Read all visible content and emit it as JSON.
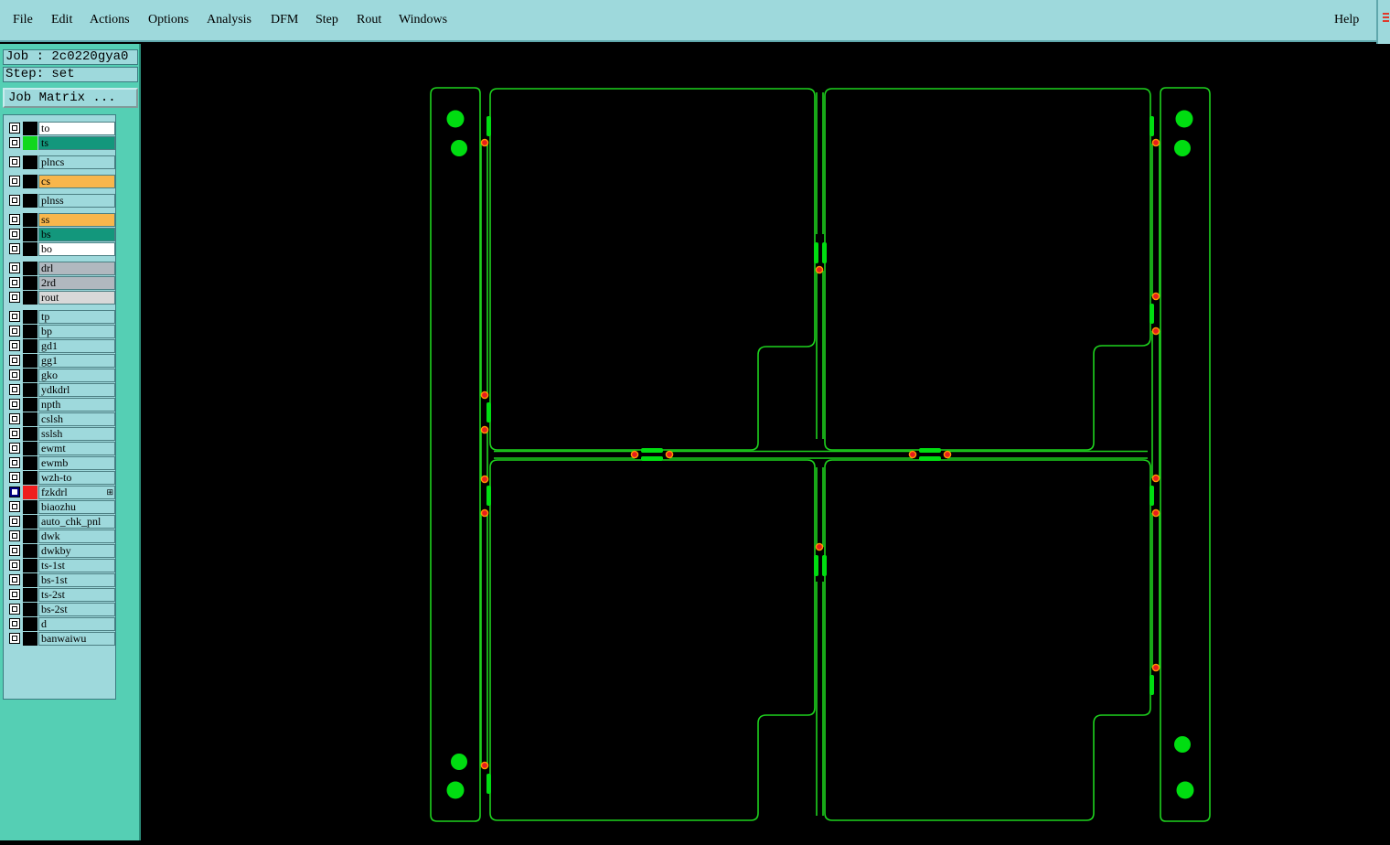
{
  "menu": {
    "items": [
      "File",
      "Edit",
      "Actions",
      "Options",
      "Analysis",
      "DFM",
      "Step",
      "Rout",
      "Windows"
    ],
    "help": "Help"
  },
  "info": {
    "job": "Job : 2c0220gya0",
    "step": "Step: set",
    "job_matrix": "Job Matrix ..."
  },
  "colors": {
    "menu_bg": "#9ed9dc",
    "panel_bg": "#55cfb4",
    "outline": "#1ed21e",
    "pad": "#00dd11",
    "marker_core": "#e81d1d",
    "marker_ring": "#ff9900"
  },
  "layers": [
    {
      "name": "to",
      "bg": "#ffffff",
      "color": "#000000"
    },
    {
      "name": "ts",
      "bg": "#13977c",
      "color": "#11d81d"
    },
    {
      "name": "plncs",
      "bg": "#9ed9dc",
      "color": "#000000"
    },
    {
      "name": "cs",
      "bg": "#f8b64c",
      "color": "#000000"
    },
    {
      "name": "plnss",
      "bg": "#9ed9dc",
      "color": "#000000"
    },
    {
      "name": "ss",
      "bg": "#f8b64c",
      "color": "#000000"
    },
    {
      "name": "bs",
      "bg": "#13977c",
      "color": "#000000"
    },
    {
      "name": "bo",
      "bg": "#ffffff",
      "color": "#000000"
    },
    {
      "name": "drl",
      "bg": "#b1b8bf",
      "color": "#000000"
    },
    {
      "name": "2rd",
      "bg": "#b1b8bf",
      "color": "#000000"
    },
    {
      "name": "rout",
      "bg": "#d8d8d8",
      "color": "#000000"
    },
    {
      "name": "tp",
      "bg": "#9ed9dc",
      "color": "#000000"
    },
    {
      "name": "bp",
      "bg": "#9ed9dc",
      "color": "#000000"
    },
    {
      "name": "gd1",
      "bg": "#9ed9dc",
      "color": "#000000"
    },
    {
      "name": "gg1",
      "bg": "#9ed9dc",
      "color": "#000000"
    },
    {
      "name": "gko",
      "bg": "#9ed9dc",
      "color": "#000000"
    },
    {
      "name": "ydkdrl",
      "bg": "#9ed9dc",
      "color": "#000000"
    },
    {
      "name": "npth",
      "bg": "#9ed9dc",
      "color": "#000000"
    },
    {
      "name": "cslsh",
      "bg": "#9ed9dc",
      "color": "#000000"
    },
    {
      "name": "sslsh",
      "bg": "#9ed9dc",
      "color": "#000000"
    },
    {
      "name": "ewmt",
      "bg": "#9ed9dc",
      "color": "#000000"
    },
    {
      "name": "ewmb",
      "bg": "#9ed9dc",
      "color": "#000000"
    },
    {
      "name": "wzh-to",
      "bg": "#9ed9dc",
      "color": "#000000"
    },
    {
      "name": "fzkdrl",
      "bg": "#9ed9dc",
      "color": "#ef1e1e",
      "selected": true
    },
    {
      "name": "biaozhu",
      "bg": "#9ed9dc",
      "color": "#000000"
    },
    {
      "name": "auto_chk_pnl",
      "bg": "#9ed9dc",
      "color": "#000000"
    },
    {
      "name": "dwk",
      "bg": "#9ed9dc",
      "color": "#000000"
    },
    {
      "name": "dwkby",
      "bg": "#9ed9dc",
      "color": "#000000"
    },
    {
      "name": "ts-1st",
      "bg": "#9ed9dc",
      "color": "#000000"
    },
    {
      "name": "bs-1st",
      "bg": "#9ed9dc",
      "color": "#000000"
    },
    {
      "name": "ts-2st",
      "bg": "#9ed9dc",
      "color": "#000000"
    },
    {
      "name": "bs-2st",
      "bg": "#9ed9dc",
      "color": "#000000"
    },
    {
      "name": "d",
      "bg": "#9ed9dc",
      "color": "#000000"
    },
    {
      "name": "banwaiwu",
      "bg": "#9ed9dc",
      "color": "#000000"
    }
  ]
}
